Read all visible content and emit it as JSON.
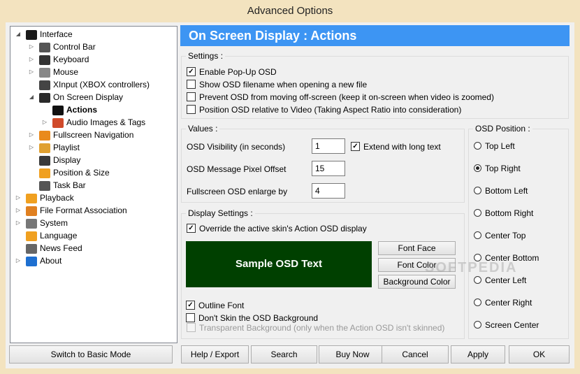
{
  "window": {
    "title": "Advanced Options"
  },
  "tree": {
    "items": [
      {
        "label": "Interface",
        "icon": "interface-icon",
        "color": "#1a1a1a"
      },
      {
        "label": "Control Bar",
        "icon": "control-bar-icon",
        "color": "#555555"
      },
      {
        "label": "Keyboard",
        "icon": "keyboard-icon",
        "color": "#333333"
      },
      {
        "label": "Mouse",
        "icon": "mouse-icon",
        "color": "#888888"
      },
      {
        "label": "XInput (XBOX controllers)",
        "icon": "gamepad-icon",
        "color": "#444444"
      },
      {
        "label": "On Screen Display",
        "icon": "monitor-icon",
        "color": "#2a2a2a"
      },
      {
        "label": "Actions",
        "icon": "running-man-icon",
        "color": "#111111"
      },
      {
        "label": "Audio Images & Tags",
        "icon": "music-note-icon",
        "color": "#d04a2a"
      },
      {
        "label": "Fullscreen Navigation",
        "icon": "fullscreen-icon",
        "color": "#e98a1c"
      },
      {
        "label": "Playlist",
        "icon": "playlist-icon",
        "color": "#e0a030"
      },
      {
        "label": "Display",
        "icon": "display-icon",
        "color": "#3a3a3a"
      },
      {
        "label": "Position & Size",
        "icon": "position-icon",
        "color": "#f0a020"
      },
      {
        "label": "Task Bar",
        "icon": "taskbar-icon",
        "color": "#555555"
      },
      {
        "label": "Playback",
        "icon": "play-icon",
        "color": "#f0a020"
      },
      {
        "label": "File Format Association",
        "icon": "file-association-icon",
        "color": "#e08020"
      },
      {
        "label": "System",
        "icon": "gear-icon",
        "color": "#777777"
      },
      {
        "label": "Language",
        "icon": "language-icon",
        "color": "#f0a020"
      },
      {
        "label": "News Feed",
        "icon": "news-icon",
        "color": "#666666"
      },
      {
        "label": "About",
        "icon": "info-icon",
        "color": "#1e6fd0"
      }
    ]
  },
  "header": {
    "title": "On Screen Display : Actions",
    "color": "#3d95f3"
  },
  "settings": {
    "legend": "Settings :",
    "options": [
      {
        "label": "Enable Pop-Up OSD",
        "checked": true
      },
      {
        "label": "Show OSD filename when opening a new file",
        "checked": false
      },
      {
        "label": "Prevent OSD from moving off-screen (keep it on-screen when video is zoomed)",
        "checked": false
      },
      {
        "label": "Position OSD relative to Video (Taking Aspect Ratio into consideration)",
        "checked": false
      }
    ]
  },
  "values": {
    "legend": "Values :",
    "visibility_label": "OSD Visibility (in seconds)",
    "visibility_value": "1",
    "extend_label": "Extend with long text",
    "extend_checked": true,
    "offset_label": "OSD Message Pixel Offset",
    "offset_value": "15",
    "enlarge_label": "Fullscreen OSD enlarge by",
    "enlarge_value": "4"
  },
  "display_settings": {
    "legend": "Display Settings :",
    "override_label": "Override the active skin's Action OSD display",
    "override_checked": true,
    "sample_text": "Sample OSD Text",
    "sample_bg": "#004000",
    "font_face_label": "Font Face",
    "font_color_label": "Font Color",
    "bg_color_label": "Background Color",
    "outline_label": "Outline Font",
    "outline_checked": true,
    "no_skin_label": "Don't Skin the OSD Background",
    "no_skin_checked": false,
    "transparent_label": "Transparent Background (only when the Action OSD isn't skinned)",
    "transparent_checked": false
  },
  "osd_position": {
    "legend": "OSD Position :",
    "options": [
      {
        "label": "Top Left",
        "checked": false
      },
      {
        "label": "Top Right",
        "checked": true
      },
      {
        "label": "Bottom Left",
        "checked": false
      },
      {
        "label": "Bottom Right",
        "checked": false
      },
      {
        "label": "Center Top",
        "checked": false
      },
      {
        "label": "Center Bottom",
        "checked": false
      },
      {
        "label": "Center Left",
        "checked": false
      },
      {
        "label": "Center Right",
        "checked": false
      },
      {
        "label": "Screen Center",
        "checked": false
      }
    ]
  },
  "watermark": "SOFTPEDIA",
  "buttons": {
    "basic_mode": "Switch to Basic Mode",
    "help": "Help / Export",
    "search": "Search",
    "buy": "Buy Now",
    "cancel": "Cancel",
    "apply": "Apply",
    "ok": "OK"
  }
}
